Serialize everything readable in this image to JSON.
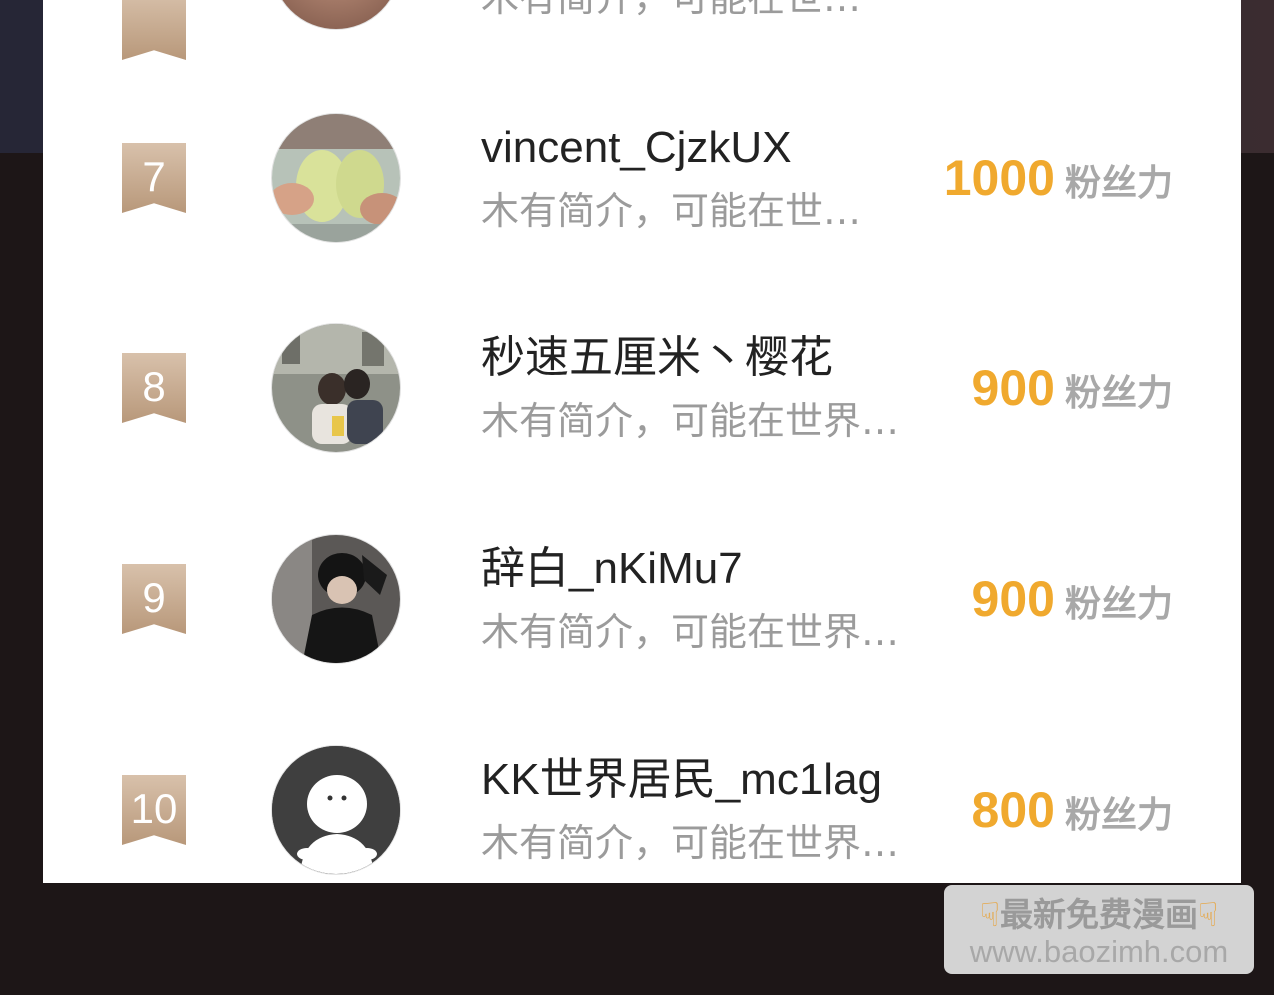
{
  "ranking": {
    "partial_top": {
      "desc": "木有简介，可能在世…"
    },
    "rows": [
      {
        "rank": "7",
        "name": "vincent_CjzkUX",
        "desc": "木有简介，可能在世…",
        "score": "1000",
        "unit": "粉丝力"
      },
      {
        "rank": "8",
        "name": "秒速五厘米丶樱花",
        "desc": "木有简介，可能在世界…",
        "score": "900",
        "unit": "粉丝力"
      },
      {
        "rank": "9",
        "name": "辞白_nKiMu7",
        "desc": "木有简介，可能在世界…",
        "score": "900",
        "unit": "粉丝力"
      },
      {
        "rank": "10",
        "name": "KK世界居民_mc1lag",
        "desc": "木有简介，可能在世界…",
        "score": "800",
        "unit": "粉丝力"
      }
    ]
  },
  "watermark": {
    "line1": "最新免费漫画",
    "line2": "www.baozimh.com",
    "icon_left": "pointing-down-hand",
    "icon_right": "pointing-down-hand"
  },
  "colors": {
    "score": "#f0a92e",
    "badge": "#c9ad93",
    "name": "#222222",
    "desc": "#9b9b9b"
  }
}
